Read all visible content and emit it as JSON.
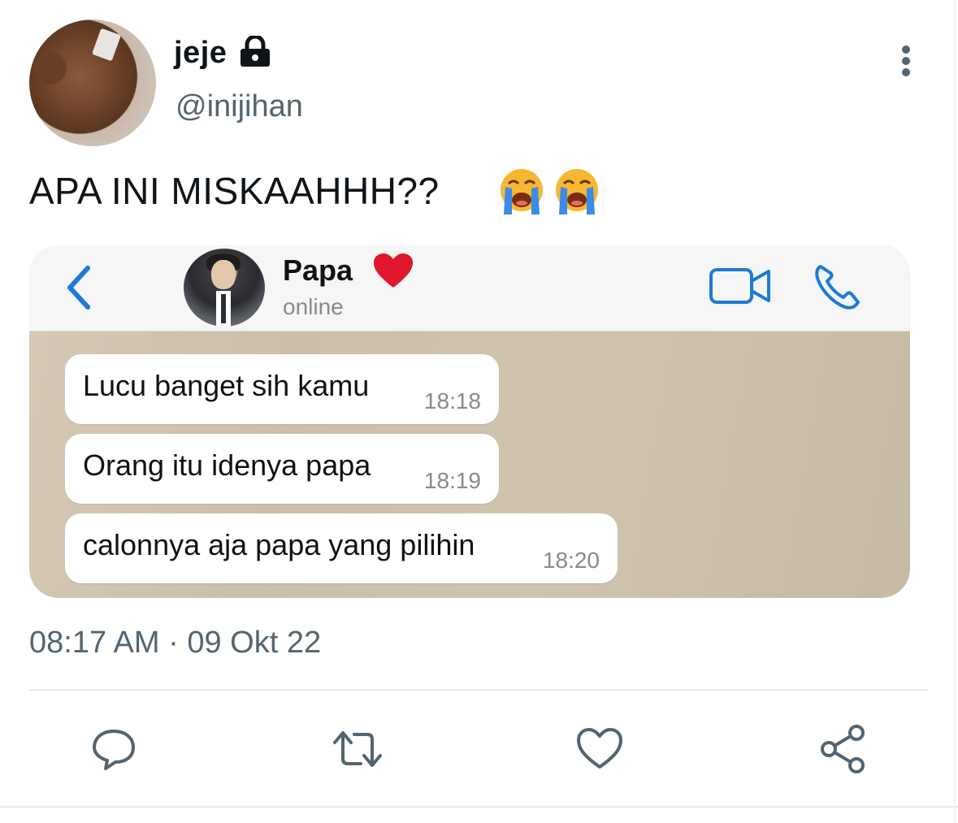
{
  "tweet": {
    "author": {
      "display_name": "jeje",
      "handle": "@inijihan",
      "protected_icon": "lock-icon",
      "avatar_icon": "teddy-bear-avatar"
    },
    "text": "APA INI MISKAAHHH??",
    "emojis": [
      "loudly-crying-face-emoji",
      "loudly-crying-face-emoji"
    ],
    "timestamp": "08:17 AM · 09 Okt 22",
    "more_icon": "more-vertical-icon"
  },
  "media": {
    "chat_header": {
      "contact_name": "Papa",
      "contact_status": "online",
      "heart_color": "#e0162b",
      "accent_color": "#1b7bd6"
    },
    "messages": [
      {
        "text": "Lucu banget sih kamu",
        "time": "18:18"
      },
      {
        "text": "Orang itu idenya papa",
        "time": "18:19"
      },
      {
        "text": "calonnya aja papa yang pilihin",
        "time": "18:20"
      }
    ]
  },
  "actions": [
    {
      "name": "reply-icon"
    },
    {
      "name": "retweet-icon"
    },
    {
      "name": "like-icon"
    },
    {
      "name": "share-icon"
    }
  ],
  "colors": {
    "secondary_text": "#536471",
    "icon_gray": "#536471",
    "divider": "#e7e9ea"
  }
}
